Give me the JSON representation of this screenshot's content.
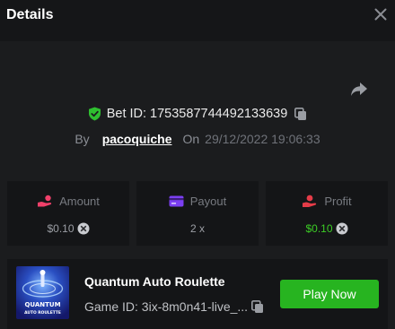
{
  "header": {
    "title": "Details"
  },
  "bet": {
    "id_label": "Bet ID: 1753587744492133639",
    "by_label": "By",
    "username": "pacoquiche",
    "on_label": "On",
    "date": "29/12/2022 19:06:33"
  },
  "stats": {
    "amount": {
      "label": "Amount",
      "value": "$0.10"
    },
    "payout": {
      "label": "Payout",
      "value": "2 x"
    },
    "profit": {
      "label": "Profit",
      "value": "$0.10"
    }
  },
  "game": {
    "name": "Quantum Auto Roulette",
    "id": "Game ID: 3ix-8m0n41-live_...",
    "play_label": "Play Now",
    "thumb_text_1": "QUANTUM",
    "thumb_text_2": "AUTO ROULETTE"
  },
  "colors": {
    "accent_green": "#27b420",
    "profit_green": "#3ccd25",
    "icon_purple": "#7b3ff2",
    "icon_pink": "#f0406a",
    "icon_red": "#e53c48"
  },
  "icons": {
    "close": "close-icon",
    "share": "share-icon",
    "verified": "shield-check-icon",
    "copy": "copy-icon",
    "amount": "coins-hand-icon",
    "payout": "card-icon",
    "profit": "profit-hand-icon",
    "coin": "coin-icon"
  }
}
